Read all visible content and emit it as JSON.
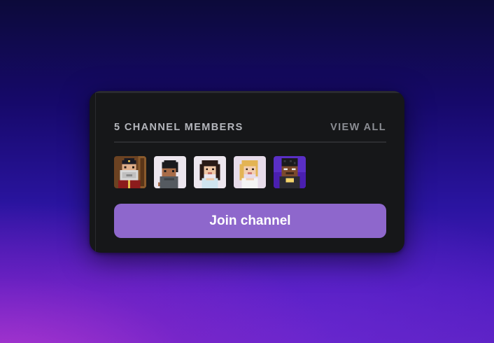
{
  "channel_card": {
    "title": "5 CHANNEL MEMBERS",
    "view_all_label": "VIEW ALL",
    "join_button_label": "Join channel",
    "accent_color": "#8e67cc",
    "card_background": "#161719"
  },
  "members": [
    {
      "icon": "pixel-avatar-captain-icon"
    },
    {
      "icon": "pixel-avatar-man-icon"
    },
    {
      "icon": "pixel-avatar-woman-dark-hair-icon"
    },
    {
      "icon": "pixel-avatar-woman-blonde-icon"
    },
    {
      "icon": "pixel-avatar-man-purple-bg-icon"
    }
  ]
}
